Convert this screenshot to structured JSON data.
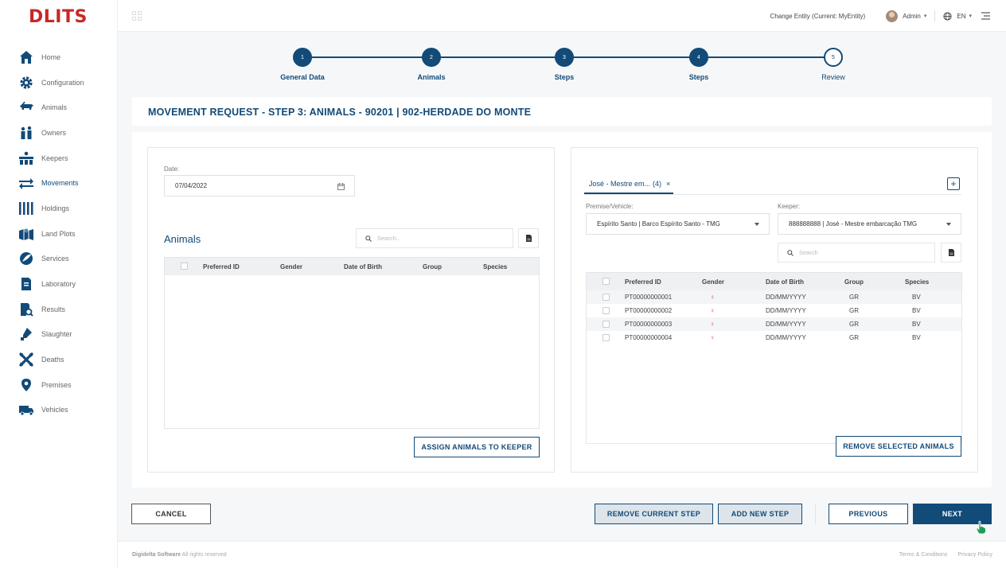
{
  "app": {
    "logo": "DLITS",
    "accent": "#124a78",
    "logo_color": "#c62828"
  },
  "topbar": {
    "entity": "Change Entity (Current: MyEntity)",
    "user": "Admin",
    "language": "EN"
  },
  "sidebar": {
    "items": [
      {
        "label": "Home",
        "icon": "home-icon"
      },
      {
        "label": "Configuration",
        "icon": "gear-icon"
      },
      {
        "label": "Animals",
        "icon": "animals-icon"
      },
      {
        "label": "Owners",
        "icon": "owners-icon"
      },
      {
        "label": "Keepers",
        "icon": "keepers-icon"
      },
      {
        "label": "Movements",
        "icon": "movements-icon"
      },
      {
        "label": "Holdings",
        "icon": "holdings-icon"
      },
      {
        "label": "Land Plots",
        "icon": "land-plots-icon"
      },
      {
        "label": "Services",
        "icon": "services-icon"
      },
      {
        "label": "Laboratory",
        "icon": "laboratory-icon"
      },
      {
        "label": "Results",
        "icon": "results-icon"
      },
      {
        "label": "Slaughter",
        "icon": "slaughter-icon"
      },
      {
        "label": "Deaths",
        "icon": "deaths-icon"
      },
      {
        "label": "Premises",
        "icon": "premises-icon"
      },
      {
        "label": "Vehicles",
        "icon": "vehicles-icon"
      }
    ],
    "active": "Movements"
  },
  "stepper": {
    "steps": [
      {
        "num": "1",
        "label": "General Data"
      },
      {
        "num": "2",
        "label": "Animals"
      },
      {
        "num": "3",
        "label": "Steps"
      },
      {
        "num": "4",
        "label": "Steps"
      },
      {
        "num": "5",
        "label": "Review"
      }
    ]
  },
  "page": {
    "title": "MOVEMENT REQUEST - STEP 3: ANIMALS - 90201 | 902-HERDADE DO MONTE"
  },
  "left_panel": {
    "date_label": "Date:",
    "date_value": "07/04/2022",
    "section_title": "Animals",
    "search_placeholder": "Search...",
    "columns": [
      "Preferred ID",
      "Gender",
      "Date of Birth",
      "Group",
      "Species"
    ],
    "assign_button": "ASSIGN ANIMALS TO KEEPER"
  },
  "right_panel": {
    "tab_label": "José - Mestre em...",
    "tab_count": "(4)",
    "tab_close": "×",
    "add_tab": "+",
    "premise_label": "Premise/Vehicle:",
    "premise_value": "Espírito Santo | Barco Espírito Santo - TMG",
    "keeper_label": "Keeper:",
    "keeper_value": "888888888 | José - Mestre embarcação TMG",
    "search_placeholder": "Search",
    "columns": [
      "Preferred ID",
      "Gender",
      "Date of Birth",
      "Group",
      "Species"
    ],
    "rows": [
      {
        "id": "PT00000000001",
        "gender": "♀",
        "dob": "DD/MM/YYYY",
        "group": "GR",
        "species": "BV"
      },
      {
        "id": "PT00000000002",
        "gender": "♀",
        "dob": "DD/MM/YYYY",
        "group": "GR",
        "species": "BV"
      },
      {
        "id": "PT00000000003",
        "gender": "♀",
        "dob": "DD/MM/YYYY",
        "group": "GR",
        "species": "BV"
      },
      {
        "id": "PT00000000004",
        "gender": "♀",
        "dob": "DD/MM/YYYY",
        "group": "GR",
        "species": "BV"
      }
    ],
    "remove_button": "REMOVE SELECTED ANIMALS"
  },
  "actions": {
    "cancel": "CANCEL",
    "remove_step": "REMOVE CURRENT STEP",
    "add_step": "ADD NEW STEP",
    "previous": "PREVIOUS",
    "next": "NEXT"
  },
  "footer": {
    "brand": "Digidelta Software",
    "rights": "All rights reserved",
    "terms": "Terms & Conditions",
    "privacy": "Privacy Policy"
  }
}
